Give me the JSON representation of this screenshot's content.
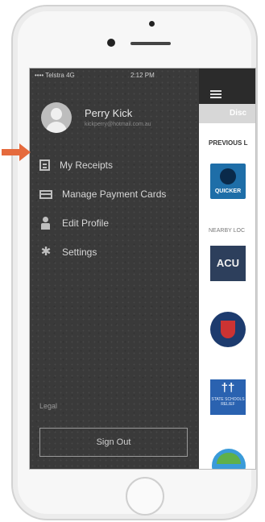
{
  "status_bar": {
    "carrier": "•••• Telstra  4G",
    "time": "2:12 PM",
    "right": "⚡ • ▬"
  },
  "profile": {
    "name": "Perry Kick",
    "email": "kickperry@hotmail.com.au"
  },
  "menu": {
    "items": [
      {
        "label": "My Receipts",
        "icon": "receipt-icon"
      },
      {
        "label": "Manage Payment Cards",
        "icon": "card-icon"
      },
      {
        "label": "Edit Profile",
        "icon": "person-icon"
      },
      {
        "label": "Settings",
        "icon": "gear-icon"
      }
    ]
  },
  "legal": "Legal",
  "sign_out": "Sign Out",
  "main": {
    "tab_label": "Disc",
    "section_previous": "PREVIOUS L",
    "section_nearby": "NEARBY LOC",
    "logos": {
      "quicker": "QUICKER",
      "acu": "ACU",
      "state": {
        "figure": "††",
        "text": "STATE SCHOOLS RELIEF"
      }
    }
  },
  "colors": {
    "drawer_bg": "#3a3a3a",
    "annotation_arrow": "#e56a3d"
  }
}
